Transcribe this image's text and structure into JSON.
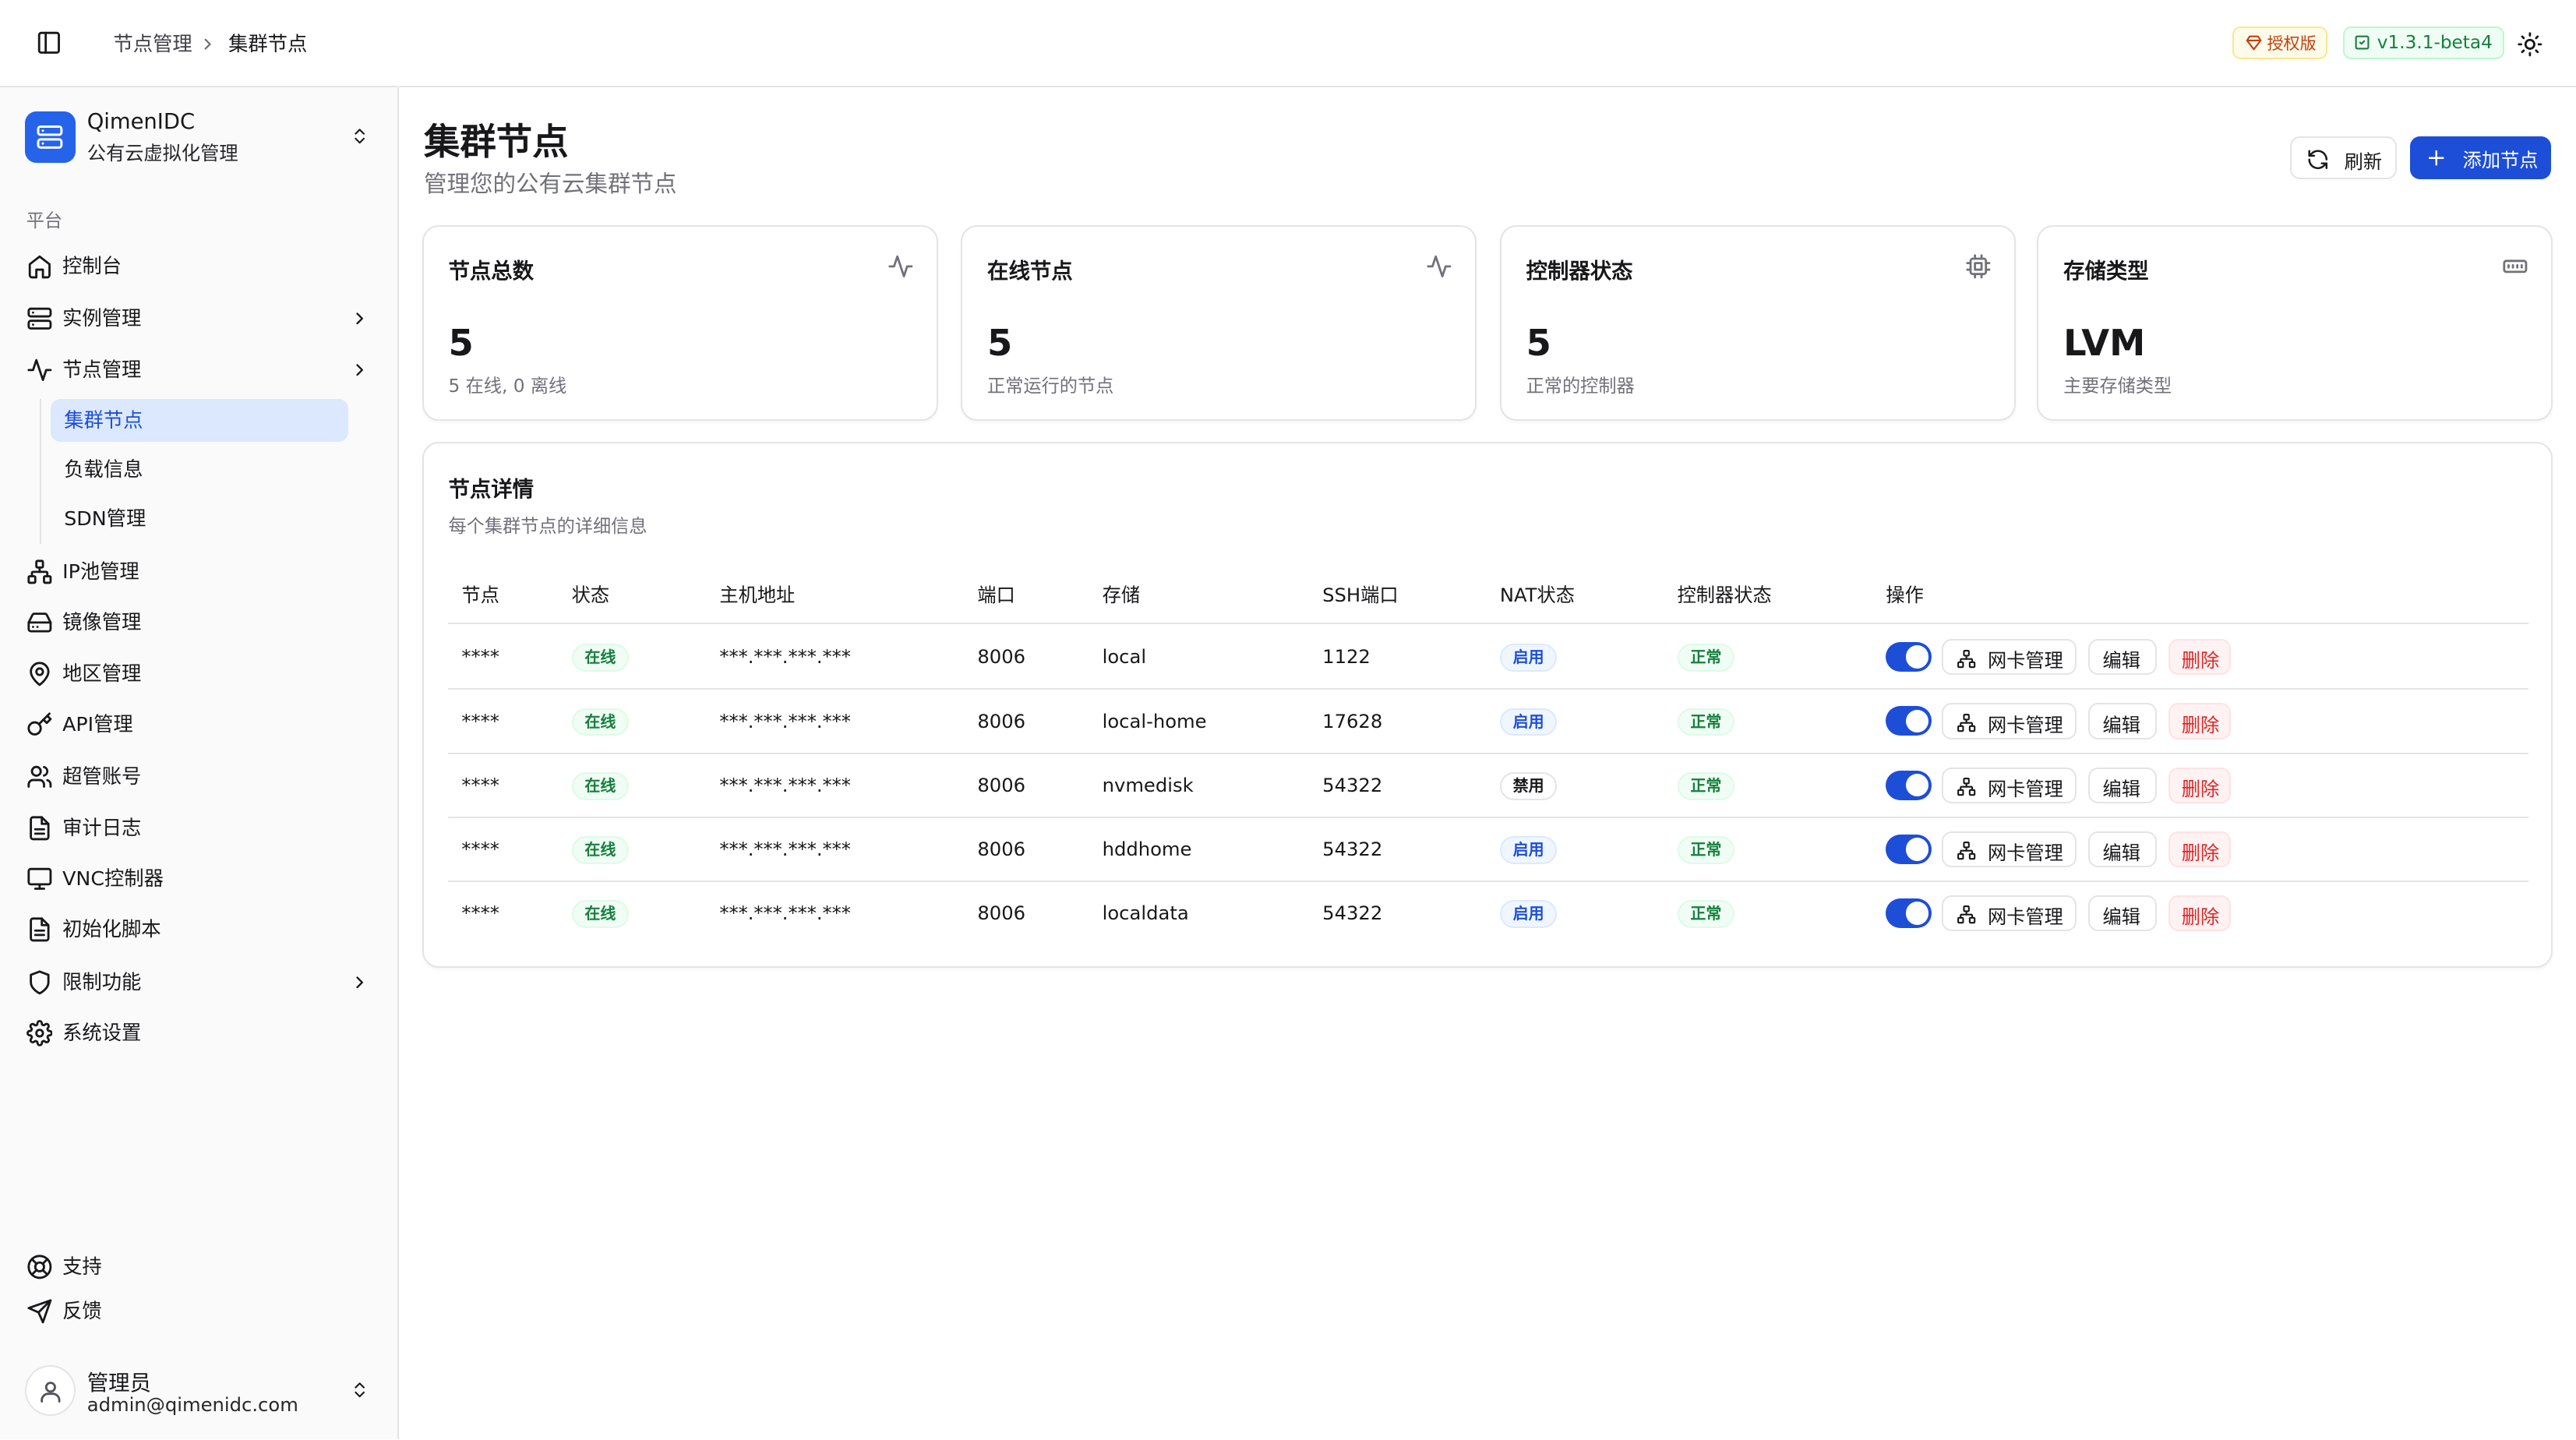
{
  "topbar": {
    "breadcrumb": [
      "节点管理",
      "集群节点"
    ],
    "license_badge": "授权版",
    "version_badge": "v1.3.1-beta4"
  },
  "brand": {
    "name": "QimenIDC",
    "subtitle": "公有云虚拟化管理"
  },
  "sidebar": {
    "group_label": "平台",
    "items": [
      {
        "label": "控制台",
        "icon": "home-icon"
      },
      {
        "label": "实例管理",
        "icon": "server-icon",
        "has_children": true
      },
      {
        "label": "节点管理",
        "icon": "activity-icon",
        "has_children": true,
        "expanded": true
      },
      {
        "label": "IP池管理",
        "icon": "network-icon"
      },
      {
        "label": "镜像管理",
        "icon": "hard-drive-icon"
      },
      {
        "label": "地区管理",
        "icon": "map-pin-icon"
      },
      {
        "label": "API管理",
        "icon": "key-icon"
      },
      {
        "label": "超管账号",
        "icon": "users-icon"
      },
      {
        "label": "审计日志",
        "icon": "file-text-icon"
      },
      {
        "label": "VNC控制器",
        "icon": "monitor-icon"
      },
      {
        "label": "初始化脚本",
        "icon": "file-code-icon"
      },
      {
        "label": "限制功能",
        "icon": "shield-icon",
        "has_children": true
      },
      {
        "label": "系统设置",
        "icon": "settings-icon"
      }
    ],
    "sub_items": [
      {
        "label": "集群节点",
        "active": true
      },
      {
        "label": "负载信息",
        "active": false
      },
      {
        "label": "SDN管理",
        "active": false
      }
    ],
    "footer": [
      {
        "label": "支持",
        "icon": "life-buoy-icon"
      },
      {
        "label": "反馈",
        "icon": "send-icon"
      }
    ],
    "user": {
      "name": "管理员",
      "email": "admin@qimenidc.com"
    }
  },
  "header": {
    "title": "集群节点",
    "subtitle": "管理您的公有云集群节点",
    "refresh_label": "刷新",
    "add_label": "添加节点"
  },
  "stats": [
    {
      "title": "节点总数",
      "value": "5",
      "sub": "5 在线, 0 离线",
      "icon": "activity-icon"
    },
    {
      "title": "在线节点",
      "value": "5",
      "sub": "正常运行的节点",
      "icon": "activity-icon"
    },
    {
      "title": "控制器状态",
      "value": "5",
      "sub": "正常的控制器",
      "icon": "cpu-icon"
    },
    {
      "title": "存储类型",
      "value": "LVM",
      "sub": "主要存储类型",
      "icon": "memory-icon"
    }
  ],
  "table": {
    "title": "节点详情",
    "subtitle": "每个集群节点的详细信息",
    "columns": [
      "节点",
      "状态",
      "主机地址",
      "端口",
      "存储",
      "SSH端口",
      "NAT状态",
      "控制器状态",
      "操作"
    ],
    "rows": [
      {
        "node": "****",
        "status": "在线",
        "host": "***.***.***.***",
        "port": "8006",
        "storage": "local",
        "ssh_port": "1122",
        "nat": "启用",
        "controller": "正常",
        "enabled": true
      },
      {
        "node": "****",
        "status": "在线",
        "host": "***.***.***.***",
        "port": "8006",
        "storage": "local-home",
        "ssh_port": "17628",
        "nat": "启用",
        "controller": "正常",
        "enabled": true
      },
      {
        "node": "****",
        "status": "在线",
        "host": "***.***.***.***",
        "port": "8006",
        "storage": "nvmedisk",
        "ssh_port": "54322",
        "nat": "禁用",
        "controller": "正常",
        "enabled": true
      },
      {
        "node": "****",
        "status": "在线",
        "host": "***.***.***.***",
        "port": "8006",
        "storage": "hddhome",
        "ssh_port": "54322",
        "nat": "启用",
        "controller": "正常",
        "enabled": true
      },
      {
        "node": "****",
        "status": "在线",
        "host": "***.***.***.***",
        "port": "8006",
        "storage": "localdata",
        "ssh_port": "54322",
        "nat": "启用",
        "controller": "正常",
        "enabled": true
      }
    ],
    "actions": {
      "nic": "网卡管理",
      "edit": "编辑",
      "delete": "删除"
    }
  },
  "colors": {
    "accent": "#1d4ed8",
    "brand": "#2563eb",
    "danger": "#dc2626",
    "success": "#15803d"
  }
}
